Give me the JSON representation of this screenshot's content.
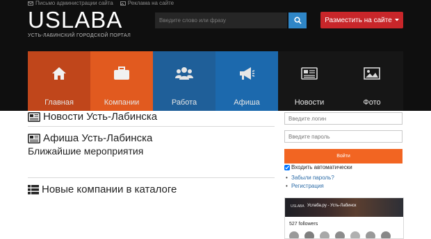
{
  "top_links": [
    {
      "icon": "envelope-icon",
      "label": "Письмо администрации сайта"
    },
    {
      "icon": "picture-icon",
      "label": "Реклама на сайте"
    }
  ],
  "logo": "USLABA",
  "tagline": "УСТЬ-ЛАБИНСКИЙ ГОРОДСКОЙ ПОРТАЛ",
  "search": {
    "placeholder": "Введите слово или фразу"
  },
  "post_button": {
    "label": "Разместить на сайте",
    "color": "#c8262a"
  },
  "nav_tiles": [
    {
      "label": "Главная",
      "icon": "home-icon",
      "color": "#c0461b"
    },
    {
      "label": "Компании",
      "icon": "briefcase-icon",
      "color": "#e15a1f"
    },
    {
      "label": "Работа",
      "icon": "users-icon",
      "color": "#1f5f99"
    },
    {
      "label": "Афиша",
      "icon": "megaphone-icon",
      "color": "#1c69ad"
    },
    {
      "label": "Новости",
      "icon": "newspaper-icon",
      "color": "#161616"
    },
    {
      "label": "Фото",
      "icon": "image-icon",
      "color": "#161616"
    }
  ],
  "sections": {
    "news": {
      "title": "Новости Усть-Лабинска",
      "icon": "newspaper-icon"
    },
    "events": {
      "title": "Афиша Усть-Лабинска",
      "subtitle": "Ближайшие мероприятия",
      "icon": "newspaper-icon"
    },
    "companies": {
      "title": "Новые компании в каталоге",
      "icon": "list-icon"
    }
  },
  "login": {
    "login_placeholder": "Введите логин",
    "password_placeholder": "Введите пароль",
    "button": "Войти",
    "remember": "Входить автоматически",
    "remember_checked": true,
    "forgot": "Забыли пароль?",
    "register": "Регистрация"
  },
  "widget": {
    "brand": "USLABA",
    "name": "Услаба.ру - Усть-Лабинск",
    "followers": "527 followers"
  },
  "colors": {
    "accent_orange": "#f26522",
    "link": "#2a6aa6",
    "search_button": "#2f86c7"
  }
}
